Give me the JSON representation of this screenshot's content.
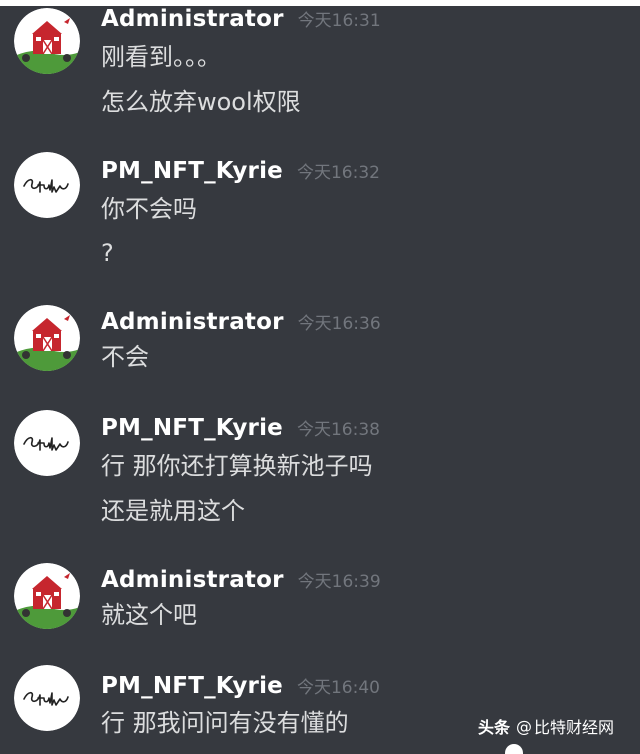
{
  "messages": [
    {
      "author": "Administrator",
      "time": "今天16:31",
      "avatar": "barn-avatar-icon",
      "lines": [
        "刚看到。。。",
        "怎么放弃wool权限"
      ]
    },
    {
      "author": "PM_NFT_Kyrie",
      "time": "今天16:32",
      "avatar": "stalin-signature-avatar-icon",
      "lines": [
        "你不会吗",
        "?"
      ]
    },
    {
      "author": "Administrator",
      "time": "今天16:36",
      "avatar": "barn-avatar-icon",
      "lines": [
        "不会"
      ]
    },
    {
      "author": "PM_NFT_Kyrie",
      "time": "今天16:38",
      "avatar": "stalin-signature-avatar-icon",
      "lines": [
        "行 那你还打算换新池子吗",
        "还是就用这个"
      ]
    },
    {
      "author": "Administrator",
      "time": "今天16:39",
      "avatar": "barn-avatar-icon",
      "lines": [
        "就这个吧"
      ]
    },
    {
      "author": "PM_NFT_Kyrie",
      "time": "今天16:40",
      "avatar": "stalin-signature-avatar-icon",
      "lines": [
        "行 那我问问有没有懂的"
      ]
    }
  ],
  "watermark": {
    "brand": "头条",
    "at": "@",
    "account": "比特财经网"
  },
  "colors": {
    "background": "#36393f",
    "author": "#ffffff",
    "timestamp": "#72767d",
    "message_text": "#dcddde"
  },
  "avatar_signature_text": "Stalin"
}
